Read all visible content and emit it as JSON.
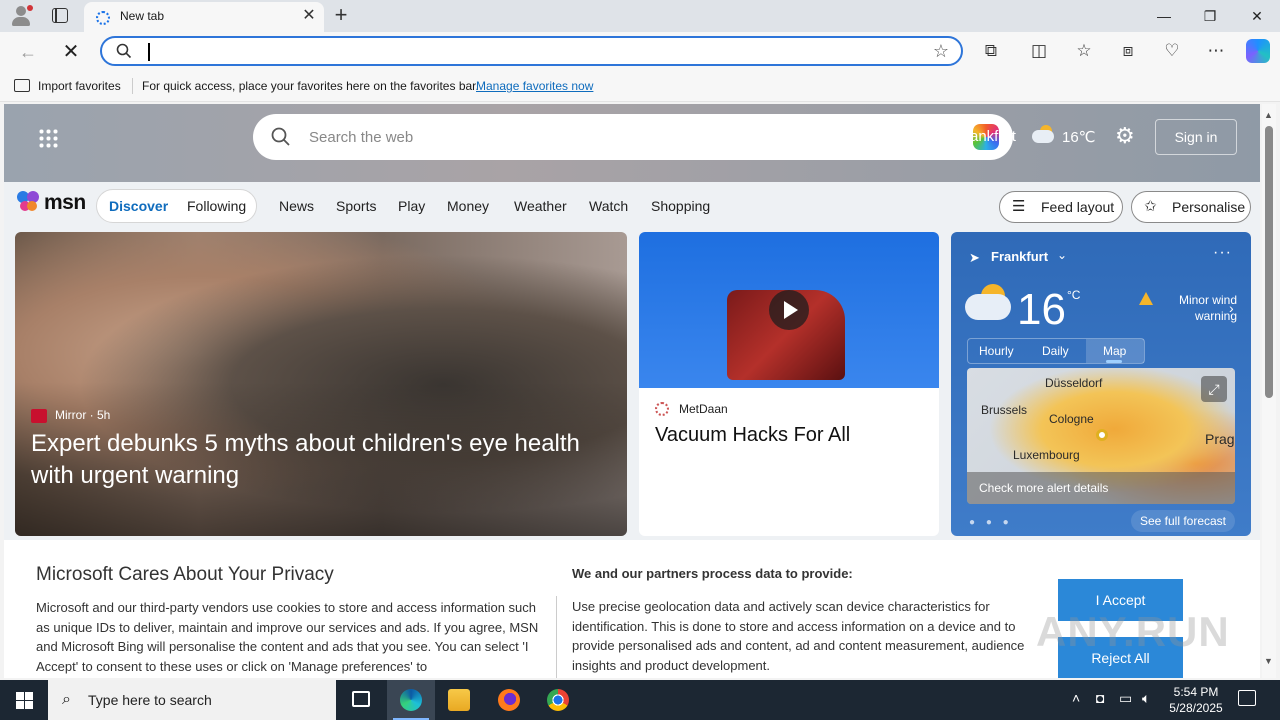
{
  "browser": {
    "tab_title": "New tab",
    "address_value": "",
    "favorites_bar": {
      "import_label": "Import favorites",
      "message": "For quick access, place your favorites here on the favorites bar.",
      "manage_link": "Manage favorites now"
    }
  },
  "msn": {
    "search_placeholder": "Search the web",
    "hero_city": "ankfurt",
    "hero_temp": "16℃",
    "sign_in": "Sign in",
    "logo_text": "msn",
    "tabs": {
      "discover": "Discover",
      "following": "Following"
    },
    "nav": [
      "News",
      "Sports",
      "Play",
      "Money",
      "Weather",
      "Watch",
      "Shopping"
    ],
    "feed_layout": "Feed layout",
    "personalise": "Personalise",
    "main_card": {
      "source": "Mirror · 5h",
      "title": "Expert debunks 5 myths about children's eye health with urgent warning"
    },
    "mid_card": {
      "source": "MetDaan",
      "title": "Vacuum Hacks For All"
    },
    "weather": {
      "city": "Frankfurt",
      "temp": "16",
      "unit": "°C",
      "warning": "Minor wind warning",
      "tabs": [
        "Hourly",
        "Daily",
        "Map"
      ],
      "map_labels": [
        "Düsseldorf",
        "Brussels",
        "Cologne",
        "Luxembourg",
        "Prag"
      ],
      "alert_link": "Check more alert details",
      "forecast_link": "See full forecast"
    }
  },
  "privacy": {
    "title": "Microsoft Cares About Your Privacy",
    "text": "Microsoft and our third-party vendors use cookies to store and access information such as unique IDs to deliver, maintain and improve our services and ads. If you agree, MSN and Microsoft Bing will personalise the content and ads that you see. You can select 'I Accept' to consent to these uses or click on 'Manage preferences' to",
    "partners_heading": "We and our partners process data to provide:",
    "partners_text": "Use precise geolocation data and actively scan device characteristics for identification. This is done to store and access information on a device and to provide personalised ads and content, ad and content measurement, audience insights and product development.",
    "accept": "I Accept",
    "reject": "Reject All"
  },
  "watermark": "ANY.RUN",
  "taskbar": {
    "search_placeholder": "Type here to search",
    "time": "5:54 PM",
    "date": "5/28/2025"
  }
}
